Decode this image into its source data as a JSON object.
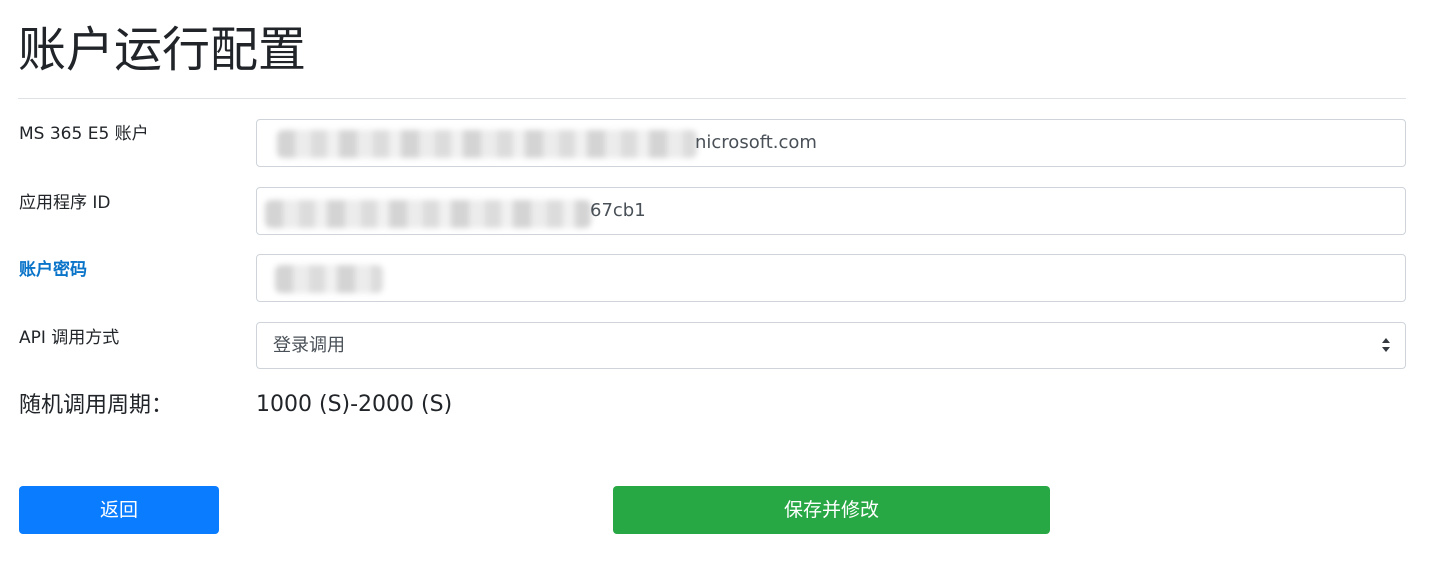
{
  "page": {
    "title": "账户运行配置"
  },
  "form": {
    "account": {
      "label": "MS 365 E5 账户",
      "visible_value": "nicrosoft.com"
    },
    "app_id": {
      "label": "应用程序 ID",
      "visible_value": "67cb1"
    },
    "password": {
      "label": "账户密码"
    },
    "api_method": {
      "label": "API 调用方式",
      "selected": "登录调用"
    },
    "period": {
      "label": "随机调用周期：",
      "value": "1000 (S)-2000 (S)"
    }
  },
  "buttons": {
    "back_label": "返回",
    "save_label": "保存并修改"
  },
  "colors": {
    "accent_label": "#0a74c9",
    "back_button": "#0a7cff",
    "save_button": "#28a745",
    "border": "#ced4da"
  }
}
